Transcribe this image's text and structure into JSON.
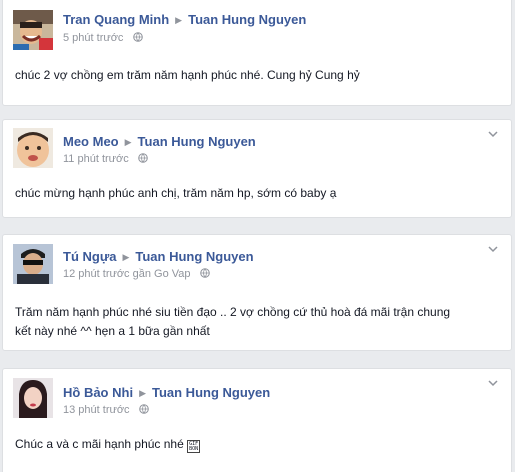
{
  "posts": [
    {
      "author": "Tran Quang Minh",
      "target": "Tuan Hung Nguyen",
      "time": "5 phút trước",
      "location": "",
      "text": "chúc 2 vợ chồng em trăm năm hạnh phúc nhé. Cung hỷ Cung hỷ",
      "avatar_icon": "profile-photo-man-smiling"
    },
    {
      "author": "Meo Meo",
      "target": "Tuan Hung Nguyen",
      "time": "11 phút trước",
      "location": "",
      "text": "chúc mừng hạnh phúc anh chị, trăm năm hp, sớm có baby ạ",
      "avatar_icon": "profile-photo-baby"
    },
    {
      "author": "Tú Ngựa",
      "target": "Tuan Hung Nguyen",
      "time": "12 phút trước",
      "location": "gần Go Vap",
      "text_line1": "Trăm năm hạnh phúc nhé siu tiền đạo .. 2 vợ chồng cứ thủ hoà đá mãi trận chung",
      "text_line2": "kết này nhé ^^ hẹn a 1 bữa gần nhất",
      "avatar_icon": "profile-photo-man-sunglasses"
    },
    {
      "author": "Hồ Bảo Nhi",
      "target": "Tuan Hung Nguyen",
      "time": "13 phút trước",
      "location": "",
      "text": "Chúc a và c mãi hạnh phúc nhé",
      "avatar_icon": "profile-photo-woman",
      "emoticon_text": "GIF BON"
    }
  ],
  "icons": {
    "arrow": "▶",
    "globe": "globe-icon",
    "chevron": "chevron-down-icon"
  },
  "colors": {
    "link": "#3b5998",
    "meta": "#90949c",
    "background": "#e9ebee"
  }
}
